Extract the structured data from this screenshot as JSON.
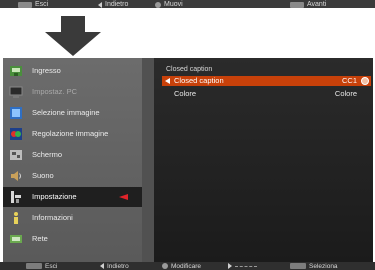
{
  "top_bar": {
    "exit_label": "Esci",
    "back_label": "Indietro",
    "move_label": "Muovi",
    "next_label": "Avanti"
  },
  "menu": {
    "items": [
      {
        "label": "Ingresso",
        "icon": "input-icon",
        "state": "normal"
      },
      {
        "label": "Impostaz. PC",
        "icon": "pc-adjust-icon",
        "state": "disabled"
      },
      {
        "label": "Selezione immagine",
        "icon": "image-select-icon",
        "state": "normal"
      },
      {
        "label": "Regolazione immagine",
        "icon": "image-adjust-icon",
        "state": "normal"
      },
      {
        "label": "Schermo",
        "icon": "screen-icon",
        "state": "normal"
      },
      {
        "label": "Suono",
        "icon": "sound-icon",
        "state": "normal"
      },
      {
        "label": "Impostazione",
        "icon": "setting-icon",
        "state": "selected"
      },
      {
        "label": "Informazioni",
        "icon": "information-icon",
        "state": "normal"
      },
      {
        "label": "Rete",
        "icon": "network-icon",
        "state": "normal"
      }
    ]
  },
  "panel": {
    "title": "Closed caption",
    "rows": [
      {
        "label": "Closed caption",
        "value": "CC1",
        "active": true
      },
      {
        "label": "Colore",
        "value": "Colore",
        "active": false
      }
    ]
  },
  "bottom_bar": {
    "exit_label": "Esci",
    "back_label": "Indietro",
    "modify_label": "Modificare",
    "select_label": "Seleziona"
  },
  "colors": {
    "selection_accent": "#c8410a",
    "pointer_red": "#e0242a",
    "menu_bg": "#636363",
    "panel_bg": "#222222"
  }
}
